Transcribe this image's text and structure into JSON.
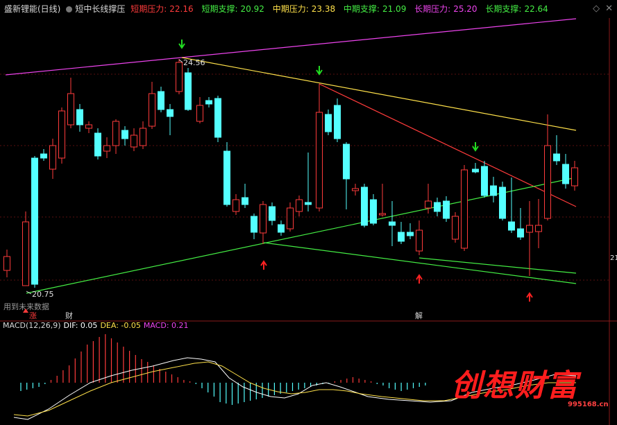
{
  "header": {
    "stock_name": "盛新锂能(日线)",
    "indicator_name": "短中长线撑压",
    "items": [
      {
        "label": "短期压力:",
        "value": "22.16",
        "color": "#ff3b3b"
      },
      {
        "label": "短期支撑:",
        "value": "20.92",
        "color": "#44ee44"
      },
      {
        "label": "中期压力:",
        "value": "23.38",
        "color": "#ffe14a"
      },
      {
        "label": "中期支撑:",
        "value": "21.09",
        "color": "#44ee44"
      },
      {
        "label": "长期压力:",
        "value": "25.20",
        "color": "#ee44ee"
      },
      {
        "label": "长期支撑:",
        "value": "22.64",
        "color": "#44ee44"
      }
    ]
  },
  "window_buttons": {
    "diamond": "◇",
    "close": "✕"
  },
  "price_chart": {
    "high_label": "24.56",
    "low_label": "20.75",
    "future_data_label": "用到未来数据",
    "right_axis_label": "21",
    "markers": [
      {
        "text": "涨",
        "color": "#ff3b3b"
      },
      {
        "text": "财",
        "color": "#d8d8d8"
      },
      {
        "text": "解",
        "color": "#d8d8d8"
      }
    ],
    "colors": {
      "up": "#ff3b3b",
      "down": "#54ffff",
      "long_res": "#ee44ee",
      "mid_res": "#ffe14a",
      "short_res": "#ff3b3b",
      "support": "#44ee44"
    }
  },
  "macd": {
    "name": "MACD(12,26,9)",
    "dif": "DIF: 0.05",
    "dea": "DEA: -0.05",
    "macd": "MACD: 0.21",
    "colors": {
      "name": "#d8d8d8",
      "dif": "#ffffff",
      "dea": "#ffe14a",
      "macd": "#ee44ee"
    }
  },
  "watermark": {
    "text": "创想财富",
    "url": "995168.cn"
  }
}
